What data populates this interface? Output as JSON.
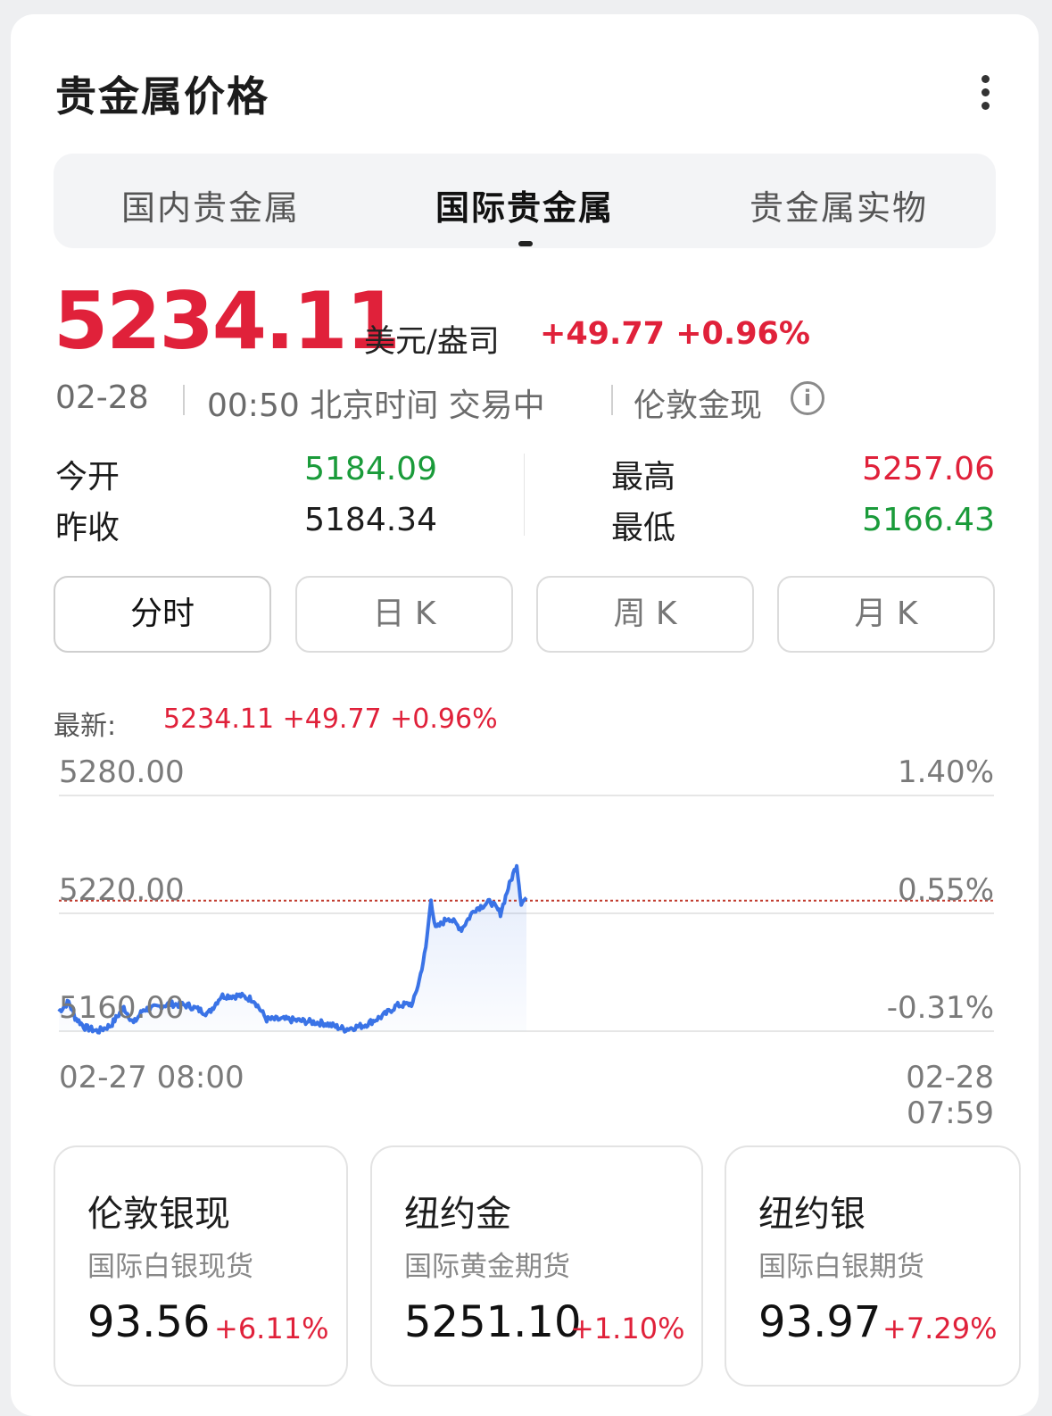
{
  "header": {
    "title": "贵金属价格"
  },
  "tabs": [
    {
      "label": "国内贵金属",
      "active": false
    },
    {
      "label": "国际贵金属",
      "active": true
    },
    {
      "label": "贵金属实物",
      "active": false
    }
  ],
  "quote": {
    "price": "5234.11",
    "unit": "美元/盎司",
    "change": "+49.77 +0.96%",
    "date": "02-28",
    "time_status": "00:50 北京时间 交易中",
    "market": "伦敦金现"
  },
  "stats": {
    "open_label": "今开",
    "open": "5184.09",
    "prev_close_label": "昨收",
    "prev_close": "5184.34",
    "high_label": "最高",
    "high": "5257.06",
    "low_label": "最低",
    "low": "5166.43"
  },
  "periods": [
    {
      "label": "分时",
      "active": true
    },
    {
      "label": "日 K",
      "active": false
    },
    {
      "label": "周 K",
      "active": false
    },
    {
      "label": "月 K",
      "active": false
    }
  ],
  "latest": {
    "label": "最新:",
    "value": "5234.11 +49.77 +0.96%"
  },
  "colors": {
    "up": "#e0213a",
    "down": "#1a9b3a",
    "line": "#3a73e6",
    "baseline": "#c0392b"
  },
  "chart_data": {
    "type": "line",
    "x_start_label": "02-27 08:00",
    "x_end_label": "02-28 07:59",
    "y_labels": [
      "5280.00",
      "5220.00",
      "5160.00"
    ],
    "y_pct_labels": [
      "1.40%",
      "0.55%",
      "-0.31%"
    ],
    "ylim": [
      5160,
      5280
    ],
    "reference_line": 5226.5,
    "xlim": [
      0,
      1440
    ],
    "series": [
      {
        "points": [
          [
            0,
            5170
          ],
          [
            15,
            5175
          ],
          [
            25,
            5167
          ],
          [
            40,
            5162
          ],
          [
            60,
            5160
          ],
          [
            80,
            5163
          ],
          [
            100,
            5172
          ],
          [
            115,
            5164
          ],
          [
            130,
            5171
          ],
          [
            150,
            5172
          ],
          [
            170,
            5174
          ],
          [
            200,
            5173
          ],
          [
            230,
            5169
          ],
          [
            250,
            5178
          ],
          [
            280,
            5178
          ],
          [
            300,
            5176
          ],
          [
            320,
            5166
          ],
          [
            350,
            5166
          ],
          [
            380,
            5165
          ],
          [
            410,
            5164
          ],
          [
            440,
            5161
          ],
          [
            470,
            5163
          ],
          [
            500,
            5168
          ],
          [
            520,
            5173
          ],
          [
            545,
            5174
          ],
          [
            555,
            5186
          ],
          [
            565,
            5202
          ],
          [
            573,
            5227
          ],
          [
            580,
            5212
          ],
          [
            600,
            5218
          ],
          [
            620,
            5212
          ],
          [
            640,
            5222
          ],
          [
            665,
            5226
          ],
          [
            680,
            5220
          ],
          [
            692,
            5233
          ],
          [
            705,
            5245
          ],
          [
            712,
            5225
          ],
          [
            720,
            5228
          ]
        ]
      }
    ]
  },
  "instruments": [
    {
      "name": "伦敦银现",
      "subtitle": "国际白银现货",
      "price": "93.56",
      "change": "+6.11%"
    },
    {
      "name": "纽约金",
      "subtitle": "国际黄金期货",
      "price": "5251.10",
      "change": "+1.10%"
    },
    {
      "name": "纽约银",
      "subtitle": "国际白银期货",
      "price": "93.97",
      "change": "+7.29%"
    }
  ]
}
